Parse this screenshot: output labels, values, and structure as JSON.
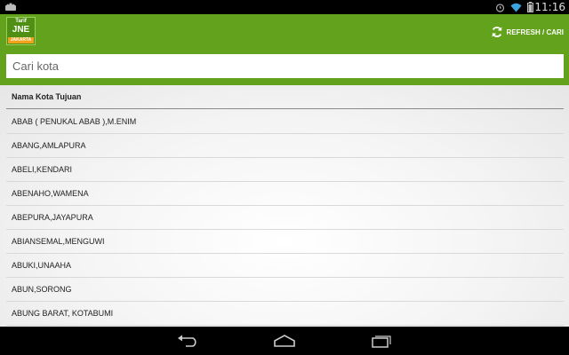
{
  "status_bar": {
    "time": "11:16",
    "icons": [
      "android-icon",
      "alarm-icon",
      "wifi-icon",
      "battery-icon"
    ]
  },
  "app": {
    "logo_line1": "Tarif",
    "logo_line2": "JNE",
    "logo_line3": "JAKARTA",
    "refresh_label": "REFRESH / CARI",
    "accent_color": "#62a21d",
    "logo_badge_color": "#f0a21a"
  },
  "search": {
    "value": "",
    "placeholder": "Cari kota"
  },
  "list": {
    "header": "Nama Kota Tujuan",
    "items": [
      "ABAB ( PENUKAL ABAB ),M.ENIM",
      "ABANG,AMLAPURA",
      "ABELI,KENDARI",
      "ABENAHO,WAMENA",
      "ABEPURA,JAYAPURA",
      "ABIANSEMAL,MENGUWI",
      "ABUKI,UNAAHA",
      "ABUN,SORONG",
      "ABUNG BARAT, KOTABUMI"
    ]
  },
  "nav_bar": {
    "buttons": [
      "back-icon",
      "home-icon",
      "recent-apps-icon"
    ]
  }
}
